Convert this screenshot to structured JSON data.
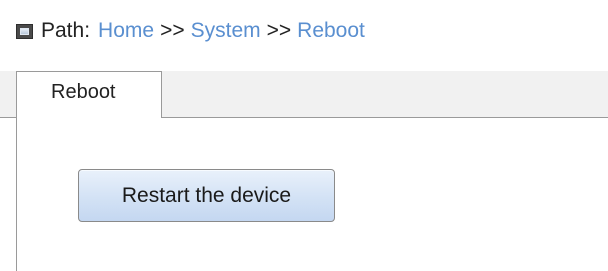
{
  "breadcrumb": {
    "icon": "window-icon",
    "label": "Path:",
    "items": [
      "Home",
      "System",
      "Reboot"
    ],
    "separator": ">>",
    "link_color": "#5a8fd0"
  },
  "tabs": [
    {
      "label": "Reboot",
      "active": true
    }
  ],
  "panel": {
    "restart_button_label": "Restart the device"
  }
}
